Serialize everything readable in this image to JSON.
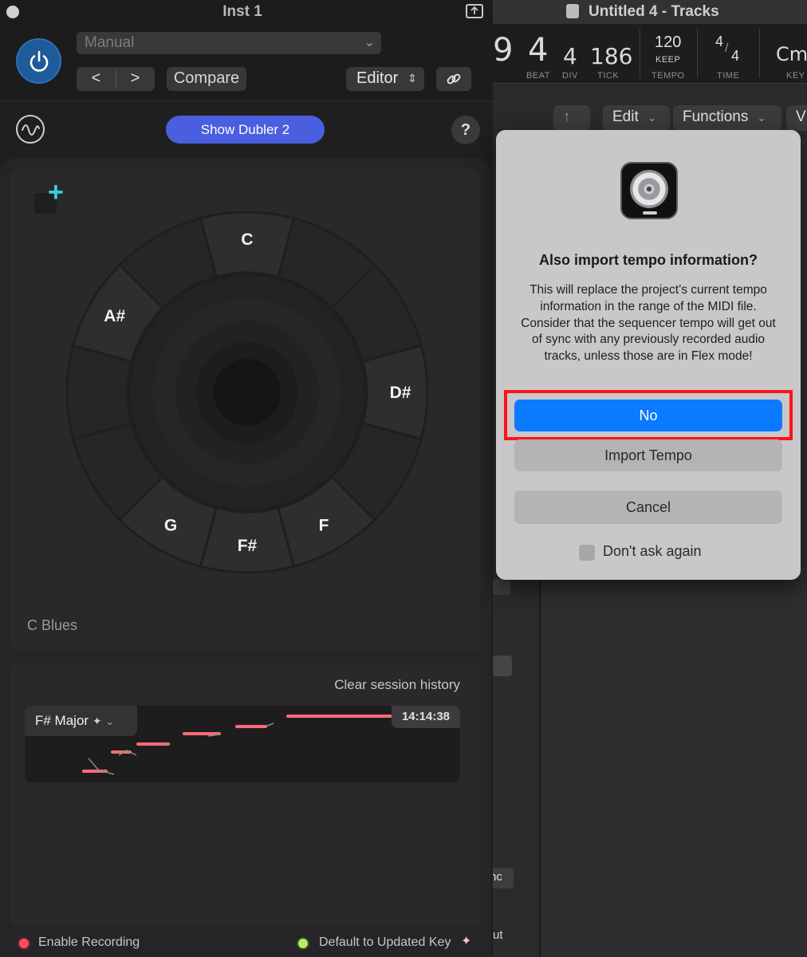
{
  "plugin": {
    "title": "Inst 1",
    "preset": "Manual",
    "compare_label": "Compare",
    "editor_label": "Editor",
    "back_glyph": "<",
    "forward_glyph": ">",
    "show_button": "Show Dubler 2",
    "help_glyph": "?",
    "add_glyph": "+",
    "scale_name": "C Blues",
    "wheel_notes": [
      "C",
      "D#",
      "F",
      "F#",
      "G",
      "A#"
    ],
    "history": {
      "clear_label": "Clear session history",
      "key_label": "F# Major",
      "timestamp": "14:14:38"
    },
    "footer": {
      "enable_recording": "Enable Recording",
      "default_key": "Default to Updated Key"
    }
  },
  "logic": {
    "window_title": "Untitled 4 - Tracks",
    "lcd": {
      "bar_partial": "9",
      "beat": "4",
      "div": "4",
      "tick": "186",
      "tempo": "120",
      "keep": "KEEP",
      "time_num": "4",
      "time_den": "4",
      "key": "Cma",
      "labels": [
        "BEAT",
        "DIV",
        "TICK",
        "TEMPO",
        "TIME",
        "KEY"
      ]
    },
    "toolbar": {
      "edit": "Edit",
      "functions": "Functions",
      "view_partial": "V"
    },
    "stub_labels": [
      "nc",
      "ut"
    ]
  },
  "dialog": {
    "title": "Also import tempo information?",
    "message": "This will replace the project’s current tempo information in the range of the MIDI file. Consider that the sequencer tempo will get out of sync with any previously recorded audio tracks, unless those are in Flex mode!",
    "buttons": {
      "no": "No",
      "import": "Import Tempo",
      "cancel": "Cancel"
    },
    "checkbox_label": "Don't ask again",
    "checkbox_checked": false
  },
  "colors": {
    "accent_blue": "#0a7aff",
    "dubler_blue": "#4a5fe0",
    "highlight_red": "#ff1414",
    "record_red": "#ff4b5c",
    "key_green": "#b7ef5a",
    "plus_teal": "#36d0d6"
  },
  "icons": [
    "power-icon",
    "chevron-left-icon",
    "chevron-right-icon",
    "link-icon",
    "waveform-icon",
    "question-icon",
    "plus-icon",
    "sparkle-icon",
    "chevron-down-icon",
    "logic-pro-icon",
    "up-arrow-icon",
    "expand-window-icon"
  ]
}
